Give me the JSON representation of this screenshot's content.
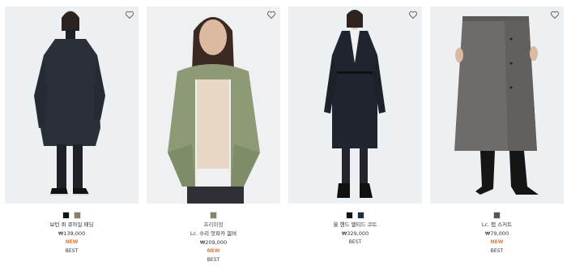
{
  "products": [
    {
      "name": "보턴 퀴 큐아일 패딩",
      "price": "₩139,000",
      "new_label": "NEW",
      "best_label": "BEST",
      "colors": [
        "#111111",
        "#8a7e6e"
      ]
    },
    {
      "subname": "프리미엄",
      "name": "Lc. 수리 앗파카 봄버",
      "price": "₩209,000",
      "new_label": "NEW",
      "best_label": "BEST",
      "colors": [
        "#7d8866"
      ]
    },
    {
      "name": "울 핸드 멜티드 코트",
      "price": "₩329,000",
      "best_label": "BEST",
      "colors": [
        "#111111",
        "#1d2b44"
      ]
    },
    {
      "name": "Lc. 랩 스커트",
      "price": "₩79,000",
      "new_label": "NEW",
      "best_label": "BEST",
      "colors": [
        "#555555"
      ]
    }
  ],
  "icons": {
    "wishlist": "heart-outline-icon"
  },
  "accent_new": "#e07b3a"
}
